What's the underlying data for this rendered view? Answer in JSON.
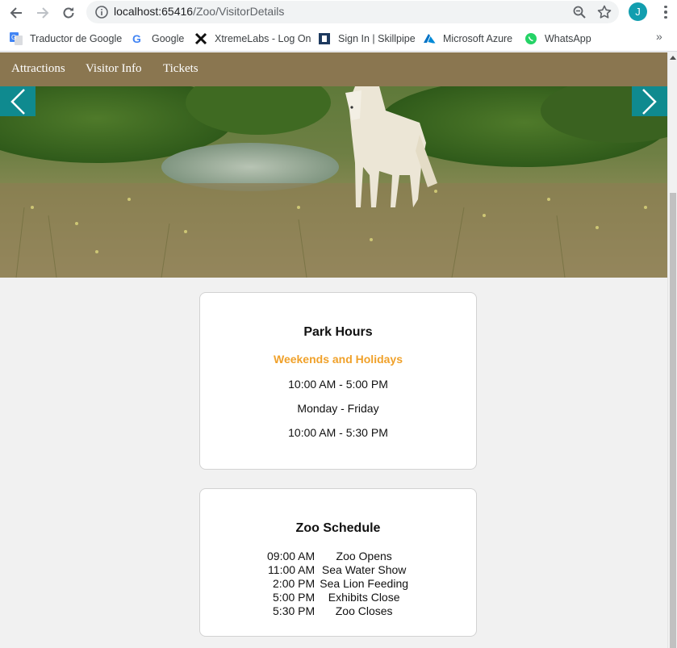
{
  "browser": {
    "url_host": "localhost:65416",
    "url_path": "/Zoo/VisitorDetails",
    "avatar_letter": "J",
    "bookmarks": [
      {
        "label": "Traductor de Google",
        "icon": "google-translate-icon"
      },
      {
        "label": "Google",
        "icon": "google-icon"
      },
      {
        "label": "XtremeLabs - Log On",
        "icon": "xtremelabs-icon"
      },
      {
        "label": "Sign In | Skillpipe",
        "icon": "skillpipe-icon"
      },
      {
        "label": "Microsoft Azure",
        "icon": "azure-icon"
      },
      {
        "label": "WhatsApp",
        "icon": "whatsapp-icon"
      }
    ],
    "bookmarks_more": "»"
  },
  "nav": {
    "items": [
      "Attractions",
      "Visitor Info",
      "Tickets"
    ],
    "color": "#8a7650"
  },
  "hero": {
    "arrow_color": "#0f8a8f"
  },
  "park_hours": {
    "title": "Park Hours",
    "weekend_label": "Weekends and Holidays",
    "weekend_hours": "10:00 AM - 5:00 PM",
    "weekday_label": "Monday - Friday",
    "weekday_hours": "10:00 AM - 5:30 PM",
    "highlight_color": "#f0a12a"
  },
  "schedule": {
    "title": "Zoo Schedule",
    "rows": [
      {
        "time": "09:00 AM",
        "event": "Zoo Opens"
      },
      {
        "time": "11:00 AM",
        "event": "Sea Water Show"
      },
      {
        "time": "2:00 PM",
        "event": "Sea Lion Feeding"
      },
      {
        "time": "5:00 PM",
        "event": "Exhibits Close"
      },
      {
        "time": "5:30 PM",
        "event": "Zoo Closes"
      }
    ]
  }
}
